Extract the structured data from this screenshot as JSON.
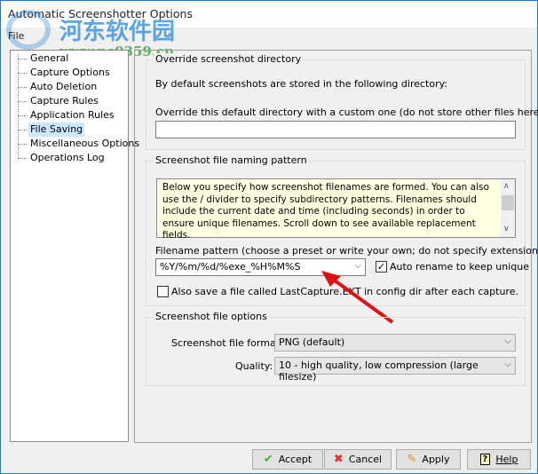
{
  "window": {
    "title": "Automatic Screenshotter Options",
    "menu": [
      "File"
    ]
  },
  "watermark": {
    "cn": "河东软件园",
    "url": "www.pc0359.cn"
  },
  "tree": {
    "items": [
      {
        "label": "General"
      },
      {
        "label": "Capture Options"
      },
      {
        "label": "Auto Deletion"
      },
      {
        "label": "Capture Rules"
      },
      {
        "label": "Application Rules"
      },
      {
        "label": "File Saving",
        "selected": true
      },
      {
        "label": "Miscellaneous Options"
      },
      {
        "label": "Operations Log"
      }
    ]
  },
  "override": {
    "title": "Override screenshot directory",
    "desc": "By default screenshots are stored in the following directory:",
    "custom_label": "Override this default directory with a custom one (do not store other files here!)",
    "custom_value": ""
  },
  "naming": {
    "title": "Screenshot file naming pattern",
    "info": "Below you specify how screenshot filenames are formed.  You can also use the / divider to specify subdirectory patterns.  Filenames should include the current date and time (including seconds) in order to ensure unique filenames.  Scroll down to see available replacement fields.",
    "pattern_label": "Filename pattern (choose a preset or write your own; do not specify extension):",
    "pattern_value": "%Y/%m/%d/%exe_%H%M%S",
    "auto_rename_label": "Auto rename to keep unique",
    "auto_rename_checked": true,
    "also_save_label": "Also save a file called LastCapture.EXT in config dir after each capture.",
    "also_save_checked": false
  },
  "options": {
    "title": "Screenshot file options",
    "format_label": "Screenshot file format:",
    "format_value": "PNG (default)",
    "quality_label": "Quality:",
    "quality_value": "10 - high quality, low compression (large filesize)"
  },
  "buttons": {
    "accept": "Accept",
    "cancel": "Cancel",
    "apply": "Apply",
    "help": "Help"
  },
  "colors": {
    "accent": "#1979ca",
    "selection": "#cce8ff",
    "info_bg": "#ffffe1"
  }
}
